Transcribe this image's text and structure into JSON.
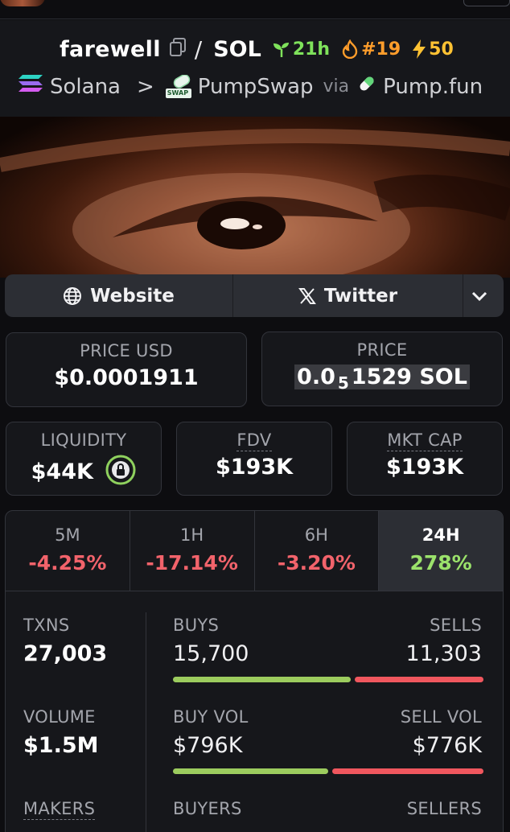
{
  "header": {
    "pair_name": "farewell",
    "slash": "/",
    "quote": "SOL",
    "age": "21h",
    "rank": "#19",
    "boosts": "50",
    "chain": "Solana",
    "sep": ">",
    "dex": "PumpSwap",
    "dex_icon_text": "SWAP",
    "via": "via",
    "launchpad": "Pump.fun"
  },
  "links": {
    "website": "Website",
    "twitter": "Twitter"
  },
  "prices": {
    "usd_label": "PRICE USD",
    "usd_value": "$0.0001911",
    "native_label": "PRICE",
    "native_prefix": "0.0",
    "native_zeros": "5",
    "native_digits": "1529 SOL"
  },
  "metrics": {
    "liquidity_label": "LIQUIDITY",
    "liquidity_value": "$44K",
    "fdv_label": "FDV",
    "fdv_value": "$193K",
    "mcap_label": "MKT CAP",
    "mcap_value": "$193K"
  },
  "tabs": [
    {
      "label": "5M",
      "value": "-4.25%"
    },
    {
      "label": "1H",
      "value": "-17.14%"
    },
    {
      "label": "6H",
      "value": "-3.20%"
    },
    {
      "label": "24H",
      "value": "278%"
    }
  ],
  "stats": {
    "txns_label": "TXNS",
    "txns_value": "27,003",
    "buys_label": "BUYS",
    "buys_value": "15,700",
    "sells_label": "SELLS",
    "sells_value": "11,303",
    "buy_share": 0.581,
    "volume_label": "VOLUME",
    "volume_value": "$1.5M",
    "buyvol_label": "BUY VOL",
    "buyvol_value": "$796K",
    "sellvol_label": "SELL VOL",
    "sellvol_value": "$776K",
    "buyvol_share": 0.506,
    "makers_label": "MAKERS",
    "buyers_label": "BUYERS",
    "sellers_label": "SELLERS"
  },
  "colors": {
    "positive": "#9be26b",
    "negative": "#f2636b",
    "age_green": "#7fe25b",
    "rank_orange": "#ff9d2b",
    "boost_yellow": "#ffc233"
  },
  "icons": [
    "copy-icon",
    "seedling-icon",
    "flame-icon",
    "lightning-icon",
    "solana-icon",
    "pumpswap-icon",
    "pill-icon",
    "globe-icon",
    "x-logo-icon",
    "chevron-down-icon",
    "lock-icon"
  ]
}
